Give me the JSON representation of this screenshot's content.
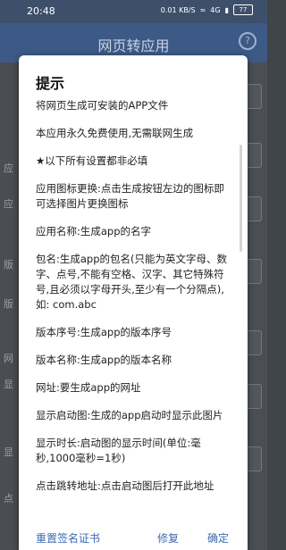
{
  "status_bar": {
    "time": "20:48",
    "speed": "0.01 KB/S",
    "network": "4G",
    "battery": "77"
  },
  "app_bar": {
    "title": "网页转应用",
    "help_icon": "help-icon"
  },
  "background_labels": [
    "应",
    "应",
    "版",
    "版",
    "网",
    "显",
    "显",
    "点"
  ],
  "dialog": {
    "title": "提示",
    "paragraphs": [
      "将网页生成可安装的APP文件",
      "本应用永久免费使用,无需联网生成",
      "★以下所有设置都非必填",
      "应用图标更换:点击生成按钮左边的图标即可选择图片更换图标",
      "应用名称:生成app的名字",
      "包名:生成app的包名(只能为英文字母、数字、点号,不能有空格、汉字、其它特殊符号,且必须以字母开头,至少有一个分隔点),如: com.abc",
      "版本序号:生成app的版本序号",
      "版本名称:生成app的版本名称",
      "网址:要生成app的网址",
      "显示启动图:生成的app启动时显示此图片",
      "显示时长:启动图的显示时间(单位:毫秒,1000毫秒=1秒)",
      "点击跳转地址:点击启动图后打开此地址"
    ],
    "buttons": {
      "reset_cert": "重置签名证书",
      "fix": "修复",
      "confirm": "确定"
    }
  }
}
